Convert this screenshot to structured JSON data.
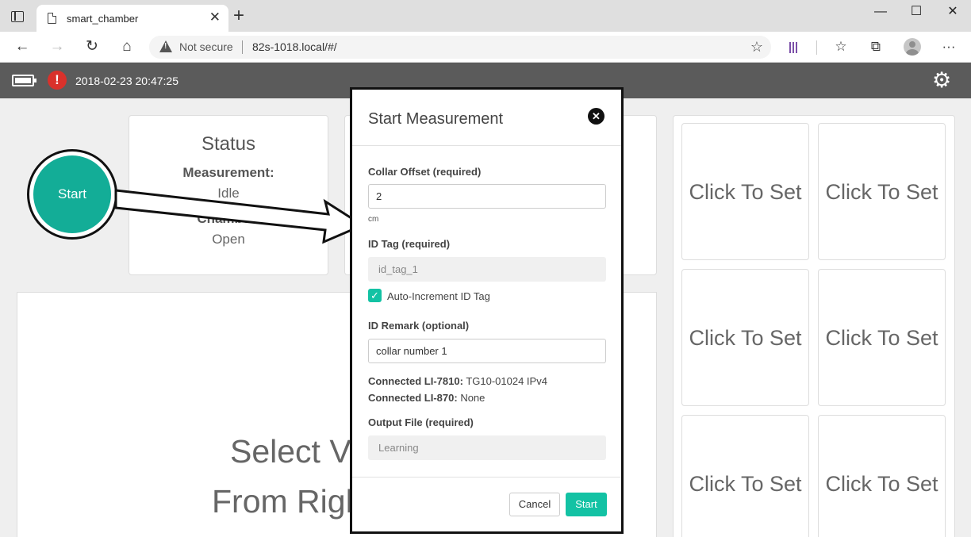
{
  "browser": {
    "tab_title": "smart_chamber",
    "tab_close": "✕",
    "new_tab": "+",
    "not_secure": "Not secure",
    "url": "82s-1018.local/#/",
    "win_minimize": "—",
    "win_maximize": "☐",
    "win_close": "✕"
  },
  "header": {
    "datetime": "2018-02-23 20:47:25",
    "alert_glyph": "!"
  },
  "start_button": {
    "label": "Start"
  },
  "status_card": {
    "title": "Status",
    "measurement_label": "Measurement:",
    "measurement_value": "Idle",
    "chamber_label": "Chamber:",
    "chamber_value": "Open"
  },
  "main": {
    "line1": "Select Va",
    "line2": "From Righ"
  },
  "tiles": [
    {
      "label": "Click To Set"
    },
    {
      "label": "Click To Set"
    },
    {
      "label": "Click To Set"
    },
    {
      "label": "Click To Set"
    },
    {
      "label": "Click To Set"
    },
    {
      "label": "Click To Set"
    }
  ],
  "modal": {
    "title": "Start Measurement",
    "collar_label": "Collar Offset (required)",
    "collar_value": "2",
    "collar_unit": "cm",
    "id_tag_label": "ID Tag (required)",
    "id_tag_value": "id_tag_1",
    "auto_increment_label": "Auto-Increment ID Tag",
    "auto_increment_checked": true,
    "remark_label": "ID Remark (optional)",
    "remark_value": "collar number 1",
    "li7810_label": "Connected LI-7810:",
    "li7810_value": "TG10-01024 IPv4",
    "li870_label": "Connected LI-870:",
    "li870_value": "None",
    "output_label": "Output File (required)",
    "output_value": "Learning",
    "cancel_label": "Cancel",
    "start_label": "Start"
  },
  "colors": {
    "accent": "#13c2a4",
    "start_circle": "#13ad97",
    "header_bg": "#5b5b5b",
    "alert": "#d9312b"
  }
}
